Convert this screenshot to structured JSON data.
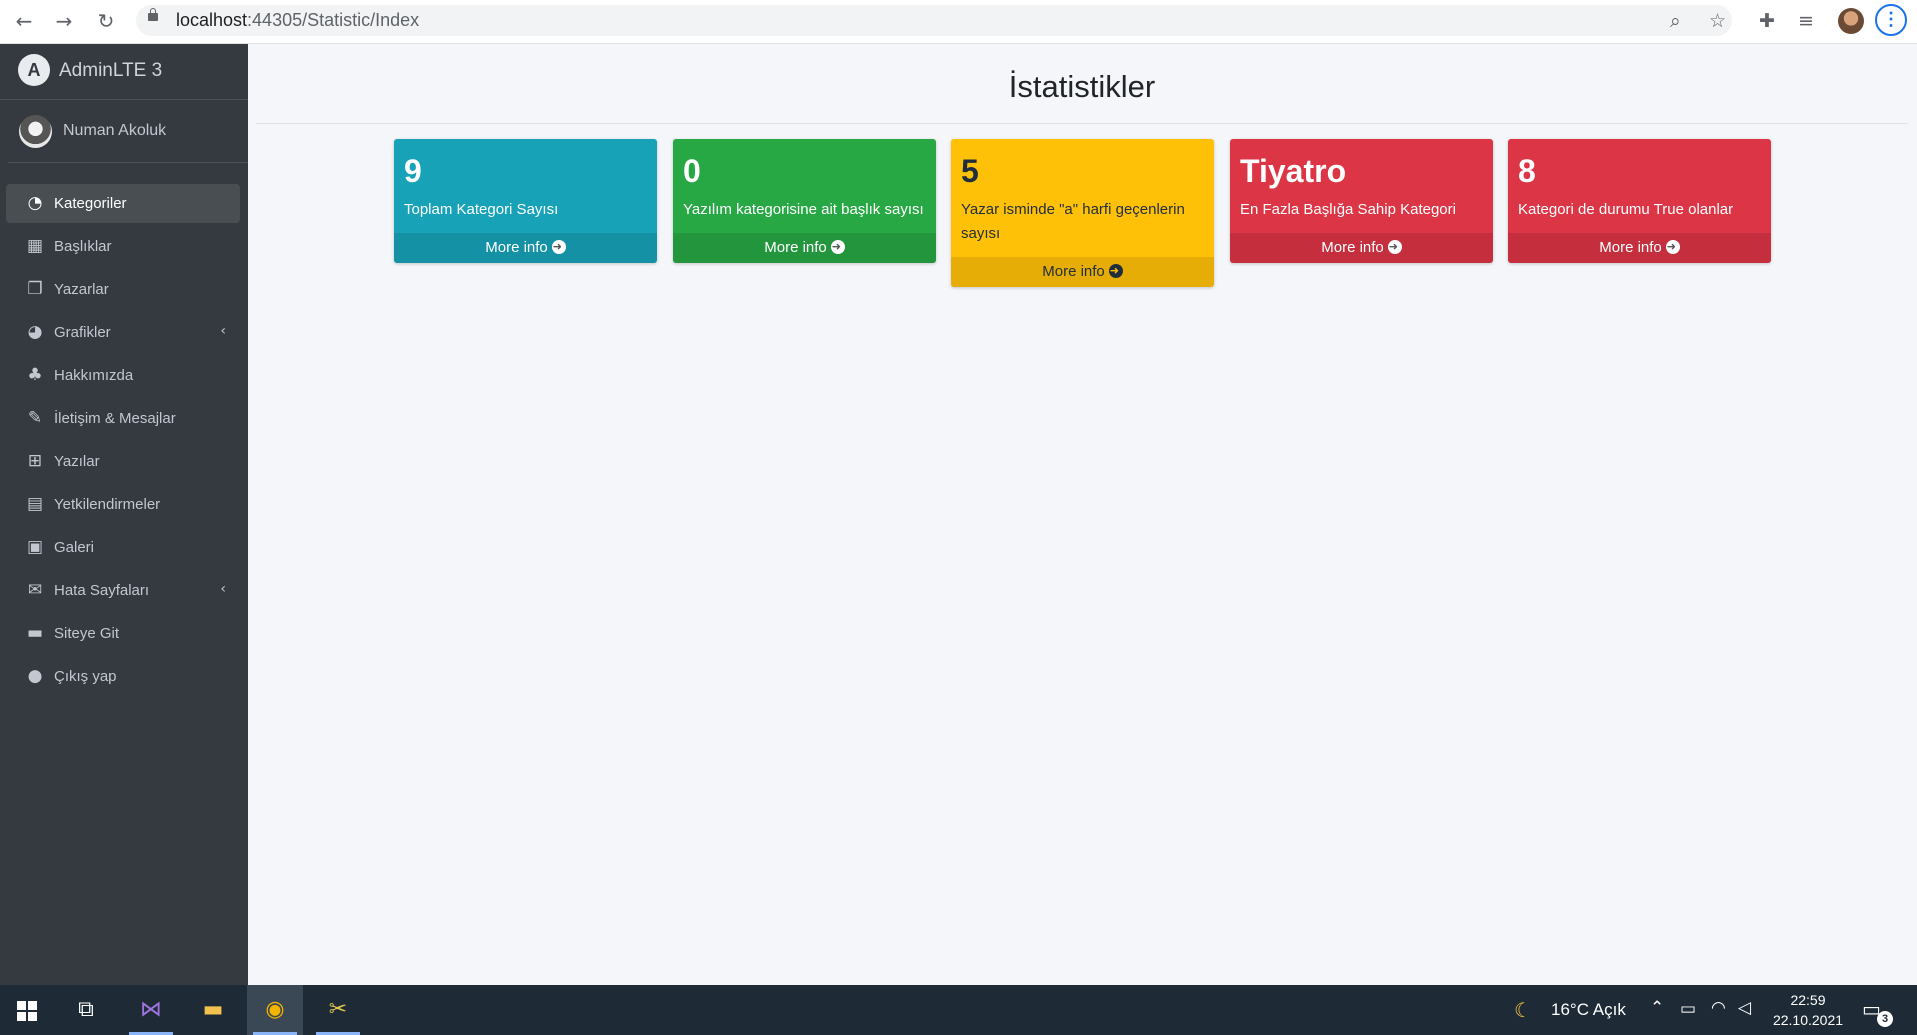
{
  "browser": {
    "url_host": "localhost",
    "url_rest": ":44305/Statistic/Index",
    "menu_glyph": "⋮"
  },
  "sidebar": {
    "brand": "AdminLTE 3",
    "brand_logo": "A",
    "user": "Numan Akoluk",
    "items": [
      {
        "label": "Kategoriler",
        "icon": "tachometer-icon",
        "glyph": "◔",
        "active": true
      },
      {
        "label": "Başlıklar",
        "icon": "grid-icon",
        "glyph": "▦"
      },
      {
        "label": "Yazarlar",
        "icon": "copy-icon",
        "glyph": "❐"
      },
      {
        "label": "Grafikler",
        "icon": "pie-chart-icon",
        "glyph": "◕",
        "caret": "‹"
      },
      {
        "label": "Hakkımızda",
        "icon": "tree-icon",
        "glyph": "♣"
      },
      {
        "label": "İletişim & Mesajlar",
        "icon": "edit-icon",
        "glyph": "✎"
      },
      {
        "label": "Yazılar",
        "icon": "table-icon",
        "glyph": "⊞"
      },
      {
        "label": "Yetkilendirmeler",
        "icon": "calendar-icon",
        "glyph": "▤"
      },
      {
        "label": "Galeri",
        "icon": "image-icon",
        "glyph": "▣"
      },
      {
        "label": "Hata Sayfaları",
        "icon": "envelope-icon",
        "glyph": "✉",
        "caret": "‹"
      },
      {
        "label": "Siteye Git",
        "icon": "book-icon",
        "glyph": "▬"
      },
      {
        "label": "Çıkış yap",
        "icon": "apple-icon",
        "glyph": "●"
      }
    ]
  },
  "main": {
    "title": "İstatistikler",
    "more_info": "More info",
    "boxes": [
      {
        "value": "9",
        "text": "Toplam Kategori Sayısı",
        "color": "#17a2b8"
      },
      {
        "value": "0",
        "text": "Yazılım kategorisine ait başlık sayısı",
        "color": "#28a745"
      },
      {
        "value": "5",
        "text": "Yazar isminde \"a\" harfi geçenlerin sayısı",
        "color": "#ffc107"
      },
      {
        "value": "Tiyatro",
        "text": "En Fazla Başlığa Sahip Kategori",
        "color": "#dc3545"
      },
      {
        "value": "8",
        "text": "Kategori de durumu True olanlar",
        "color": "#dc3545"
      }
    ]
  },
  "taskbar": {
    "weather": "16°C  Açık",
    "time": "22:59",
    "date": "22.10.2021",
    "notifications": "3"
  }
}
